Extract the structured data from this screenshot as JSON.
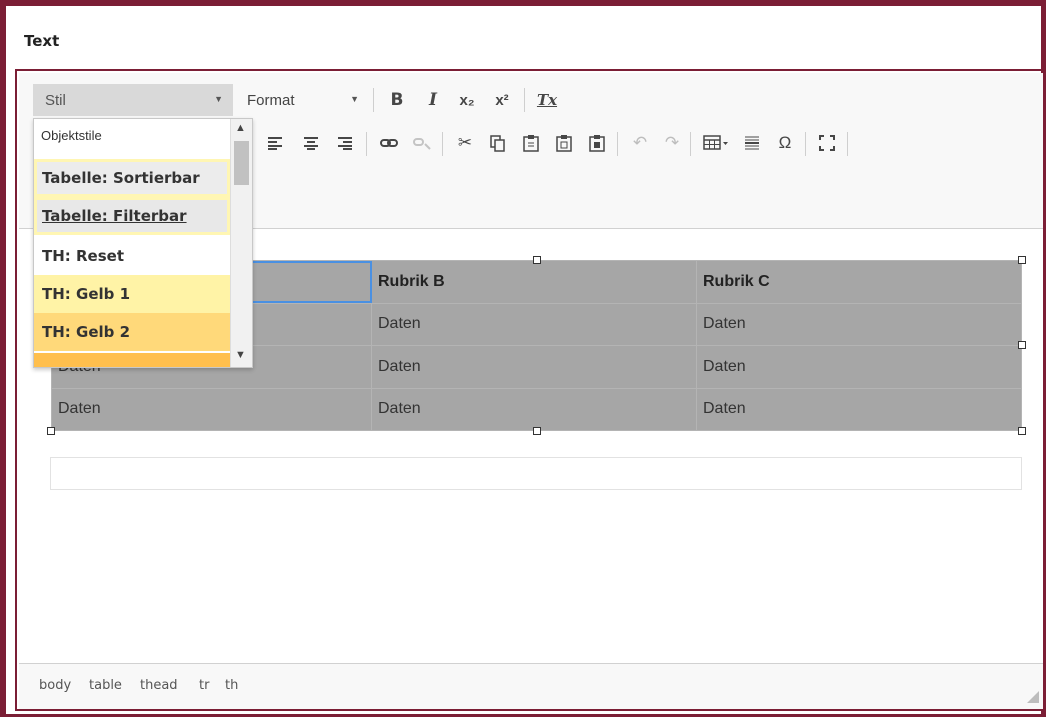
{
  "panel": {
    "title": "Text"
  },
  "toolbar": {
    "stil_label": "Stil",
    "format_label": "Format",
    "bold": "B",
    "italic": "I",
    "subscript": "x₂",
    "superscript": "x²",
    "remove_format": "Tx",
    "special_char": "Ω"
  },
  "dropdown": {
    "header": "Objektstile",
    "items": [
      {
        "label": "Tabelle: Sortierbar",
        "bg": "#ececec",
        "highlight": "#fff6b3"
      },
      {
        "label": "Tabelle: Filterbar",
        "bg": "#e8e8e8",
        "highlight": "#fff6b3"
      },
      {
        "label": "TH: Reset",
        "bg": "#ffffff"
      },
      {
        "label": "TH: Gelb 1",
        "bg": "#fff3a6"
      },
      {
        "label": "TH: Gelb 2",
        "bg": "#ffd97a"
      }
    ]
  },
  "table": {
    "headers": [
      "",
      "Rubrik B",
      "Rubrik C"
    ],
    "rows": [
      [
        "",
        "Daten",
        "Daten"
      ],
      [
        "Daten",
        "Daten",
        "Daten"
      ],
      [
        "Daten",
        "Daten",
        "Daten"
      ]
    ]
  },
  "statusbar": {
    "path": [
      "body",
      "table",
      "thead",
      "tr",
      "th"
    ]
  },
  "colors": {
    "frame": "#7b1e35",
    "table_bg": "#a6a6a6",
    "selection": "#4a90e2"
  }
}
